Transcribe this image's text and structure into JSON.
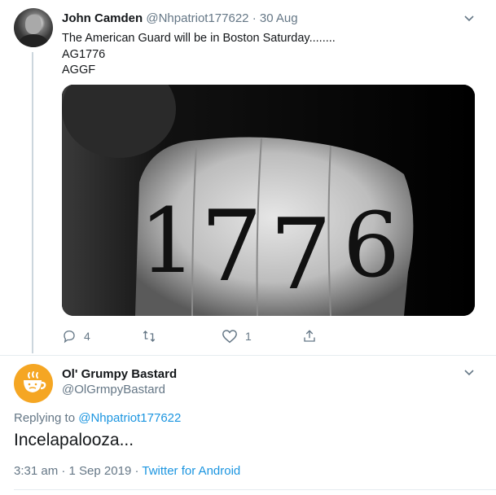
{
  "tweet1": {
    "name": "John Camden",
    "handle": "@Nhpatriot177622",
    "separator": "·",
    "date": "30 Aug",
    "lines": [
      "The American Guard will be in Boston Saturday........",
      "AG1776",
      "AGGF"
    ],
    "media": {
      "description_icon": "fist-photo",
      "tattoo_digits": [
        "1",
        "7",
        "7",
        "6"
      ]
    },
    "actions": {
      "reply_count": "4",
      "retweet_count": "",
      "like_count": "1"
    }
  },
  "tweet2": {
    "name": "Ol' Grumpy Bastard",
    "handle": "@OlGrmpyBastard",
    "replying_prefix": "Replying to",
    "replying_to": "@Nhpatriot177622",
    "body": "Incelapalooza...",
    "time": "3:31 am",
    "separator": "·",
    "date": "1 Sep 2019",
    "separator2": "·",
    "source": "Twitter for Android"
  },
  "colors": {
    "accent": "#1b95e0",
    "muted": "#657786",
    "text": "#14171a",
    "avatar2_bg": "#f5a623"
  }
}
